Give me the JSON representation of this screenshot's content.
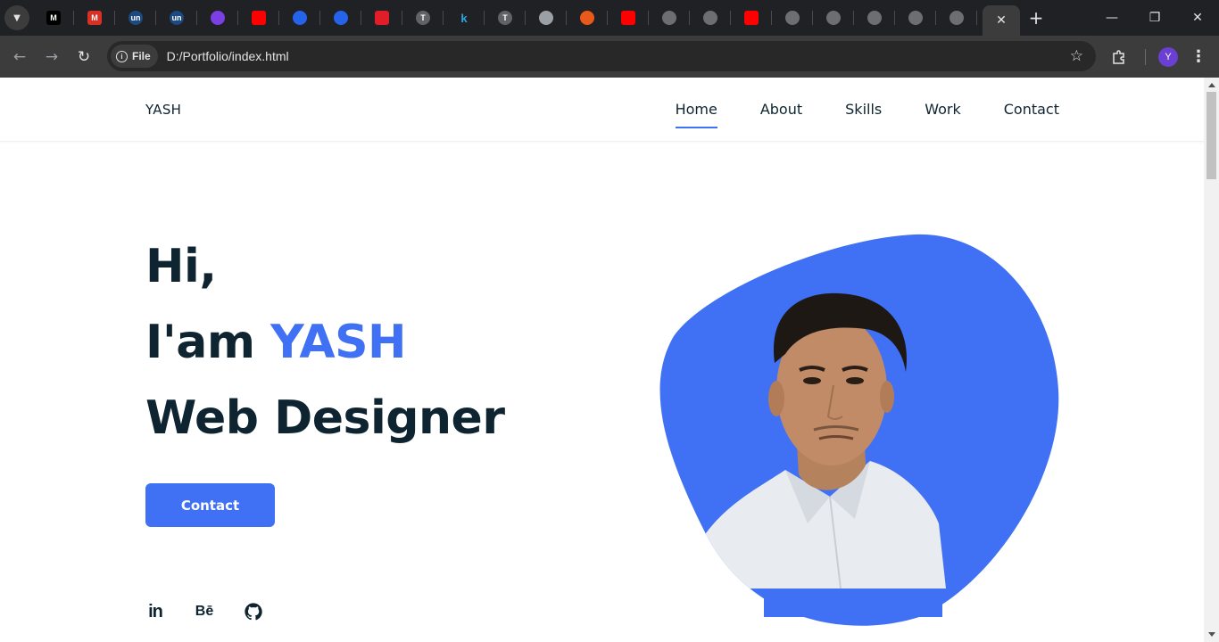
{
  "browser": {
    "tabs": [
      {
        "icon": "medium-icon",
        "label": "M"
      },
      {
        "icon": "gmail-icon",
        "label": "M"
      },
      {
        "icon": "unstop-icon",
        "label": "un"
      },
      {
        "icon": "unstop-icon",
        "label": "un"
      },
      {
        "icon": "swirl-icon",
        "label": ""
      },
      {
        "icon": "youtube-icon",
        "label": ""
      },
      {
        "icon": "bookmark-app-icon",
        "label": ""
      },
      {
        "icon": "bookmark-app-icon",
        "label": ""
      },
      {
        "icon": "v-logo-icon",
        "label": ""
      },
      {
        "icon": "t-circle-icon",
        "label": "T"
      },
      {
        "icon": "k-logo-icon",
        "label": "k"
      },
      {
        "icon": "t-circle-icon",
        "label": "T"
      },
      {
        "icon": "chrome-icon",
        "label": ""
      },
      {
        "icon": "arc-icon",
        "label": ""
      },
      {
        "icon": "youtube-icon",
        "label": ""
      },
      {
        "icon": "globe-icon",
        "label": ""
      },
      {
        "icon": "globe-icon",
        "label": ""
      },
      {
        "icon": "youtube-icon",
        "label": ""
      },
      {
        "icon": "globe-icon",
        "label": ""
      },
      {
        "icon": "globe-icon",
        "label": ""
      },
      {
        "icon": "globe-icon",
        "label": ""
      },
      {
        "icon": "globe-icon",
        "label": ""
      },
      {
        "icon": "globe-icon",
        "label": ""
      }
    ],
    "address_chip": "File",
    "url": "D:/Portfolio/index.html",
    "profile_initial": "Y"
  },
  "site": {
    "logo": "YASH",
    "nav": [
      {
        "label": "Home",
        "active": true
      },
      {
        "label": "About",
        "active": false
      },
      {
        "label": "Skills",
        "active": false
      },
      {
        "label": "Work",
        "active": false
      },
      {
        "label": "Contact",
        "active": false
      }
    ],
    "hero": {
      "line1": "Hi,",
      "line2_prefix": "I'am ",
      "line2_name": "YASH",
      "line3": "Web Designer",
      "button": "Contact"
    },
    "socials": [
      {
        "icon": "linkedin-icon",
        "label": "in"
      },
      {
        "icon": "behance-icon",
        "label": "Bē"
      },
      {
        "icon": "github-icon",
        "label": ""
      }
    ]
  },
  "colors": {
    "accent": "#4070f4",
    "text": "#0e2431",
    "chrome_dark": "#202124",
    "chrome_toolbar": "#3c3c3c"
  }
}
